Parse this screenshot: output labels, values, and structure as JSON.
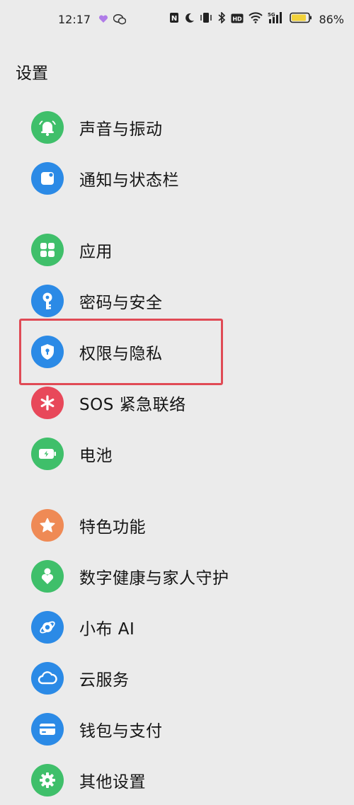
{
  "status_bar": {
    "time": "12:17",
    "battery_percent": "86%",
    "network_label": "5G",
    "hd_label": "HD",
    "nfc_label": "N"
  },
  "page": {
    "title": "设置"
  },
  "menu": [
    {
      "label": "声音与振动",
      "icon": "bell-icon",
      "color": "#3fbf6a"
    },
    {
      "label": "通知与状态栏",
      "icon": "notification-icon",
      "color": "#2b8ae6"
    },
    {
      "label": "应用",
      "icon": "apps-grid-icon",
      "color": "#3fbf6a"
    },
    {
      "label": "密码与安全",
      "icon": "key-icon",
      "color": "#2b8ae6"
    },
    {
      "label": "权限与隐私",
      "icon": "shield-lock-icon",
      "color": "#2b8ae6"
    },
    {
      "label": "SOS 紧急联络",
      "icon": "sos-asterisk-icon",
      "color": "#e8485a"
    },
    {
      "label": "电池",
      "icon": "battery-icon",
      "color": "#3fbf6a"
    },
    {
      "label": "特色功能",
      "icon": "star-icon",
      "color": "#ef8a55"
    },
    {
      "label": "数字健康与家人守护",
      "icon": "digital-wellbeing-icon",
      "color": "#3fbf6a"
    },
    {
      "label": "小布 AI",
      "icon": "ai-assistant-icon",
      "color": "#2b8ae6"
    },
    {
      "label": "云服务",
      "icon": "cloud-icon",
      "color": "#2b8ae6"
    },
    {
      "label": "钱包与支付",
      "icon": "wallet-icon",
      "color": "#2b8ae6"
    },
    {
      "label": "其他设置",
      "icon": "gear-icon",
      "color": "#3fbf6a"
    }
  ],
  "highlight": {
    "color": "#e04a55",
    "target": "权限与隐私"
  }
}
